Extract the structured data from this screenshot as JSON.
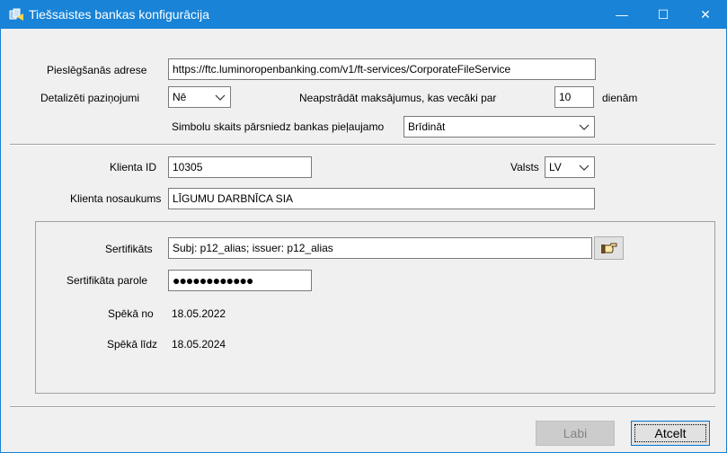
{
  "window": {
    "title": "Tiešsaistes bankas konfigurācija",
    "minimize_glyph": "—",
    "maximize_glyph": "☐",
    "close_glyph": "✕"
  },
  "form": {
    "address_label": "Pieslēgšanās adrese",
    "address_value": "https://ftc.luminoropenbanking.com/v1/ft-services/CorporateFileService",
    "notifications_label": "Detalizēti paziņojumi",
    "notifications_value": "Nē",
    "unprocessed_label": "Neapstrādāt maksājumus, kas vecāki par",
    "unprocessed_days": "10",
    "days_suffix": "dienām",
    "symbols_label": "Simbolu skaits pārsniedz bankas pieļaujamo",
    "symbols_value": "Brīdināt",
    "client_id_label": "Klienta ID",
    "client_id_value": "10305",
    "country_label": "Valsts",
    "country_value": "LV",
    "client_name_label": "Klienta nosaukums",
    "client_name_value": "LĪGUMU DARBNĪCA SIA"
  },
  "certificate": {
    "cert_label": "Sertifikāts",
    "cert_value": "Subj: p12_alias; issuer: p12_alias",
    "password_label": "Sertifikāta parole",
    "password_value": "●●●●●●●●●●●●",
    "valid_from_label": "Spēkā no",
    "valid_from_value": "18.05.2022",
    "valid_to_label": "Spēkā līdz",
    "valid_to_value": "18.05.2024",
    "pick_icon": "pointing-hand-icon"
  },
  "buttons": {
    "ok_label": "Labi",
    "cancel_label": "Atcelt"
  },
  "colors": {
    "titlebar": "#1883d7",
    "dialog_bg": "#f0f0f0"
  }
}
